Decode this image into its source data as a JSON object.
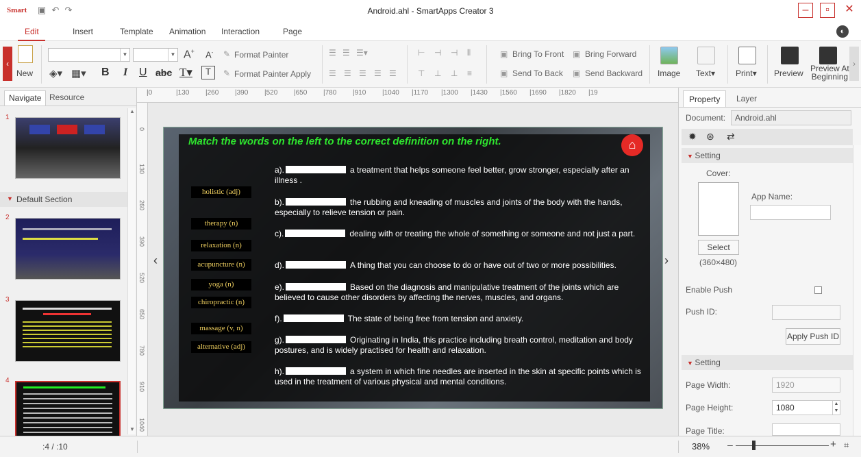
{
  "app": {
    "logo": "Smart",
    "title": "Android.ahl - SmartApps Creator 3"
  },
  "menu": {
    "items": [
      "Edit",
      "Insert",
      "Template",
      "Animation",
      "Interaction",
      "Page"
    ]
  },
  "ribbon": {
    "new_label": "New",
    "format_painter": "Format Painter",
    "format_painter_apply": "Format Painter Apply",
    "bring_to_front": "Bring To Front",
    "bring_forward": "Bring Forward",
    "send_to_back": "Send To Back",
    "send_backward": "Send Backward",
    "image_label": "Image",
    "text_label": "Text",
    "print_label": "Print",
    "preview_label": "Preview",
    "preview_at_beginning_1": "Preview At",
    "preview_at_beginning_2": "Beginning",
    "bold": "B",
    "italic": "I",
    "underline": "U",
    "strike": "abc"
  },
  "left_panel": {
    "tabs": [
      "Navigate",
      "Resource"
    ],
    "section_label": "Default Section",
    "pages": [
      "1",
      "2",
      "3",
      "4"
    ]
  },
  "ruler": {
    "top": [
      "0",
      "130",
      "260",
      "390",
      "520",
      "650",
      "780",
      "910",
      "1040",
      "1170",
      "1300",
      "1430",
      "1560",
      "1690",
      "1820",
      "19"
    ],
    "left": [
      "0",
      "130",
      "260",
      "390",
      "520",
      "650",
      "780",
      "910",
      "1040"
    ]
  },
  "slide": {
    "title": "Match the words on the left to the correct definition on the right.",
    "words": [
      "holistic (adj)",
      "therapy (n)",
      "relaxation (n)",
      "acupuncture (n)",
      "yoga (n)",
      "chiropractic (n)",
      "massage (v, n)",
      "alternative (adj)"
    ],
    "definitions": [
      {
        "letter": "a).",
        "text": "a treatment that helps someone feel better, grow stronger, especially after an illness ."
      },
      {
        "letter": "b).",
        "text": "the rubbing and kneading of muscles and joints of the body with the hands, especially to relieve tension or pain."
      },
      {
        "letter": "c).",
        "text": "dealing with or treating the whole of something or someone and not just a part."
      },
      {
        "letter": "d).",
        "text": "A thing that you can choose to do or have out of two or more possibilities."
      },
      {
        "letter": "e).",
        "text": "Based on the diagnosis and manipulative treatment of the joints which are believed to cause other disorders by affecting the nerves, muscles, and organs."
      },
      {
        "letter": "f).",
        "text": "The state of being free from tension and anxiety."
      },
      {
        "letter": "g).",
        "text": "Originating in India, this practice including breath control, meditation and body postures, and is widely practised for health and relaxation."
      },
      {
        "letter": "h).",
        "text": "a system in which fine needles are inserted in the skin at specific points which is used in the treatment of various physical and mental conditions."
      }
    ]
  },
  "right_panel": {
    "tabs": [
      "Property",
      "Layer"
    ],
    "document_label": "Document:",
    "document_value": "Android.ahl",
    "setting1": "Setting",
    "cover_label": "Cover:",
    "app_name_label": "App Name:",
    "select_button": "Select",
    "cover_size": "(360×480)",
    "enable_push": "Enable Push",
    "push_id": "Push ID:",
    "apply_push_id": "Apply Push ID",
    "setting2": "Setting",
    "page_width_label": "Page Width:",
    "page_width_value": "1920",
    "page_height_label": "Page Height:",
    "page_height_value": "1080",
    "page_title_label": "Page Title:"
  },
  "status": {
    "page_indicator": ":4  /  :10",
    "zoom": "38%"
  }
}
